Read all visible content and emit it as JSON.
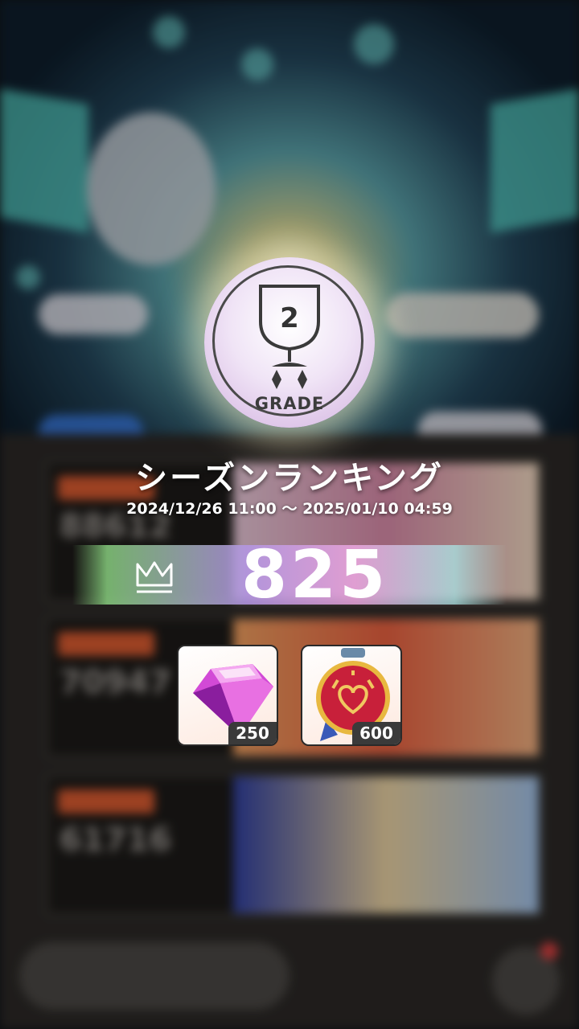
{
  "grade_badge": {
    "number": "2",
    "label": "GRADE",
    "icon": "trophy-icon"
  },
  "season": {
    "title": "シーズンランキング",
    "period": "2024/12/26 11:00 ～ 2025/01/10 04:59"
  },
  "rank": {
    "value": "825",
    "icon": "crown-icon"
  },
  "rewards": [
    {
      "name": "gem-item",
      "icon": "pink-gem-icon",
      "quantity": "250"
    },
    {
      "name": "medal-item",
      "icon": "heart-medal-icon",
      "quantity": "600"
    }
  ],
  "colors": {
    "accent_pink": "#d8a8e6",
    "rank_bar": "#b496e6",
    "qty_bg": "#3a3a3a"
  }
}
